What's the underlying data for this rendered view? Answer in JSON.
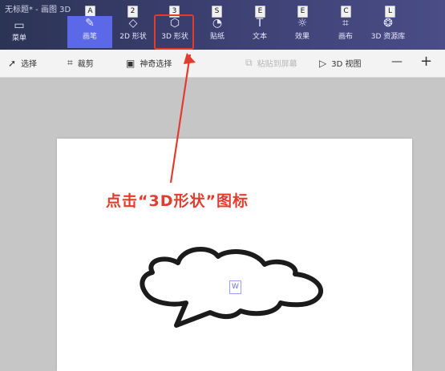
{
  "app": {
    "title": "无标题* - 画图 3D"
  },
  "menu": {
    "label": "菜单"
  },
  "tabs": [
    {
      "key": "A",
      "label": "画笔"
    },
    {
      "key": "2",
      "label": "2D 形状"
    },
    {
      "key": "3",
      "label": "3D 形状"
    },
    {
      "key": "S",
      "label": "贴纸"
    },
    {
      "key": "E",
      "label": "文本"
    },
    {
      "key": "E",
      "label": "效果"
    },
    {
      "key": "C",
      "label": "画布"
    },
    {
      "key": "L",
      "label": "3D 资源库"
    }
  ],
  "toolbar": {
    "select": "选择",
    "crop": "裁剪",
    "magic_select": "神奇选择",
    "paste": "粘贴到屏幕",
    "view_3d": "3D 视图",
    "zoom_out": "—",
    "zoom_in": "+"
  },
  "annotation": {
    "text": "点击“3D形状”图标"
  },
  "canvas_badge": {
    "text": "W"
  },
  "colors": {
    "accent": "#5b68e8",
    "annotation": "#e23c2e",
    "title_bg": "#3b3f70"
  },
  "icons": {
    "menu": "folder-icon",
    "brushes": "brush-icon",
    "shapes_2d": "shapes-2d-icon",
    "shapes_3d": "cube-icon",
    "stickers": "sticker-icon",
    "text": "text-icon",
    "effects": "sun-icon",
    "canvas": "crop-canvas-icon",
    "library": "library-icon"
  }
}
